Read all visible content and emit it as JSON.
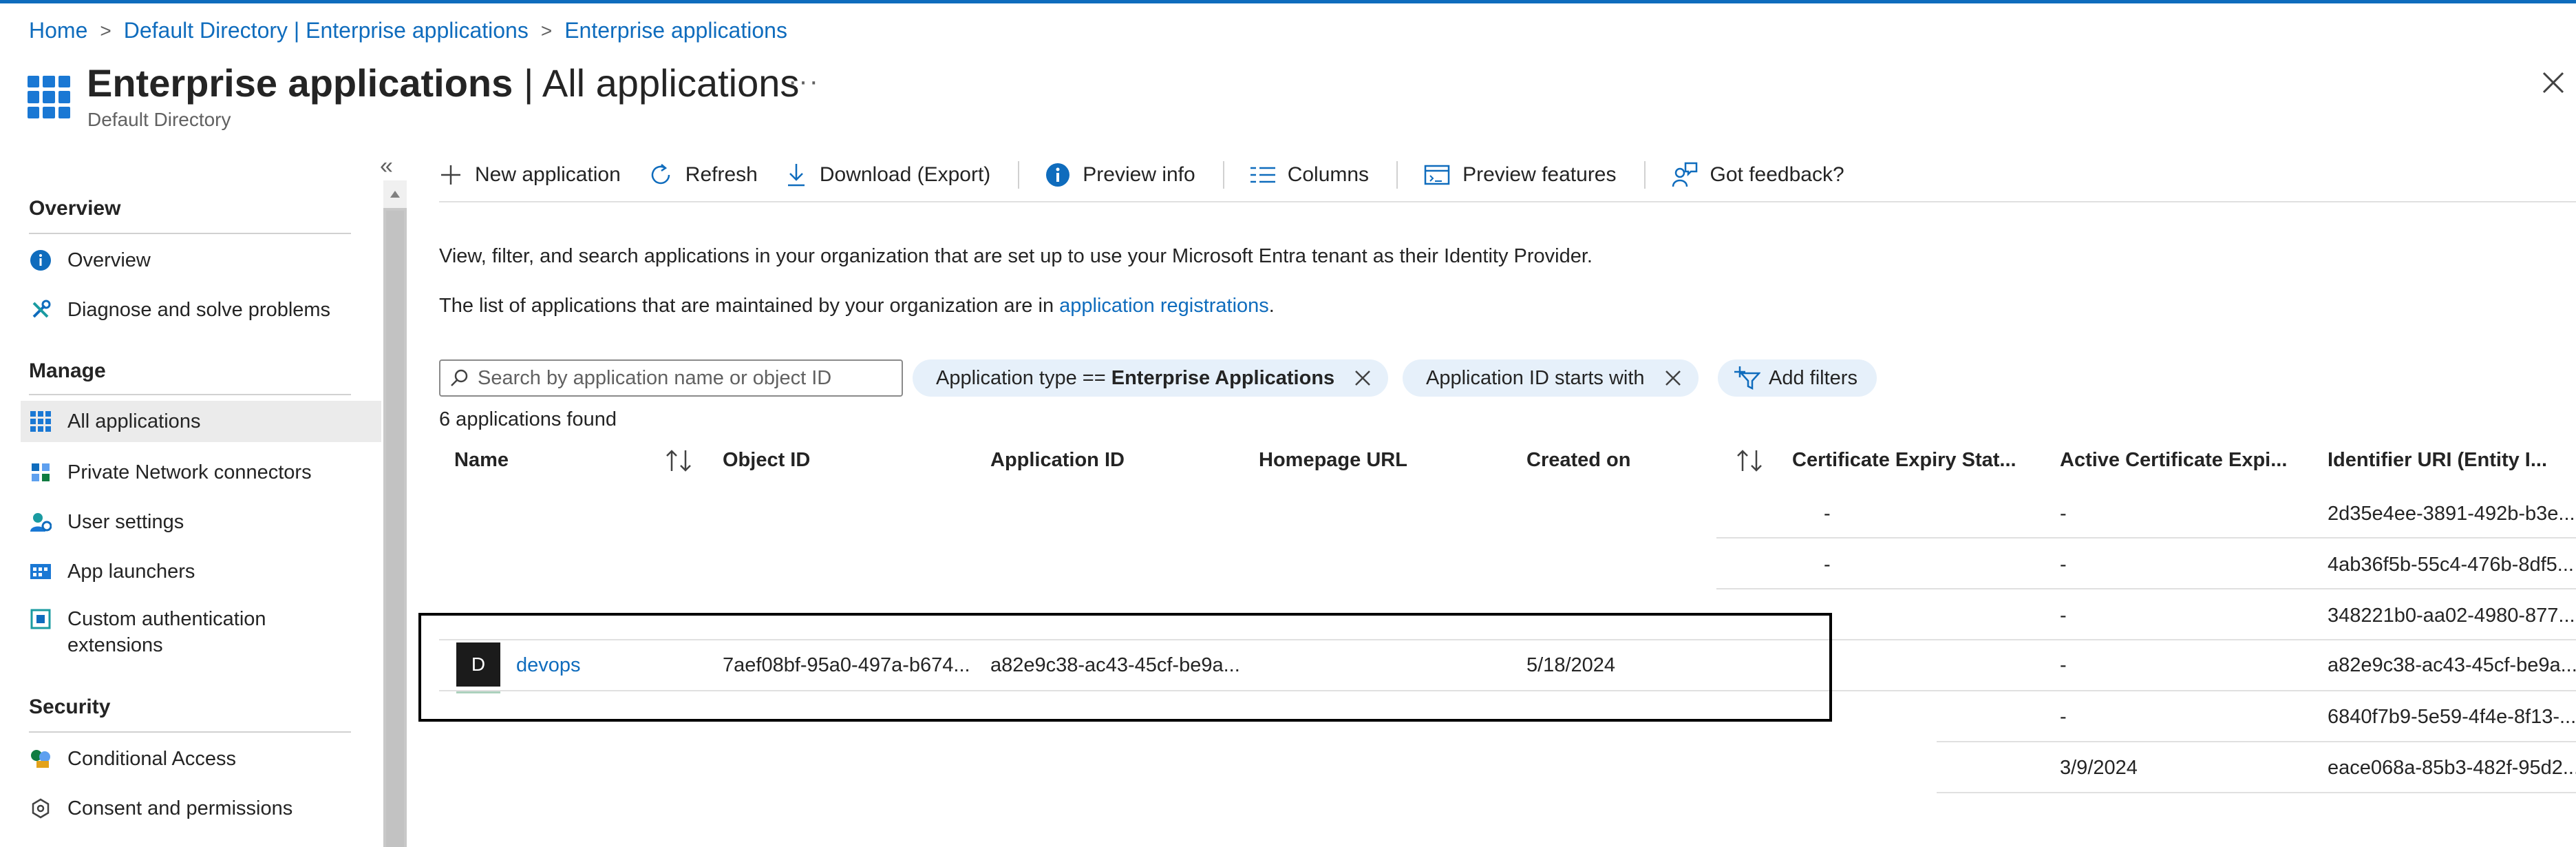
{
  "breadcrumb": [
    "Home",
    "Default Directory | Enterprise applications",
    "Enterprise applications"
  ],
  "header": {
    "title_main": "Enterprise applications",
    "title_sep": " | ",
    "title_sub": "All applications",
    "more": "···",
    "subtitle": "Default Directory"
  },
  "sidebar": {
    "collapse": "«",
    "sections": [
      {
        "heading": "Overview",
        "items": [
          {
            "label": "Overview",
            "icon": "info-icon"
          },
          {
            "label": "Diagnose and solve problems",
            "icon": "wrench-icon"
          }
        ]
      },
      {
        "heading": "Manage",
        "items": [
          {
            "label": "All applications",
            "icon": "grid-icon",
            "active": true
          },
          {
            "label": "Private Network connectors",
            "icon": "connector-icon"
          },
          {
            "label": "User settings",
            "icon": "user-settings-icon"
          },
          {
            "label": "App launchers",
            "icon": "app-launcher-icon"
          },
          {
            "label": "Custom authentication extensions",
            "icon": "extension-icon"
          }
        ]
      },
      {
        "heading": "Security",
        "items": [
          {
            "label": "Conditional Access",
            "icon": "conditional-access-icon"
          },
          {
            "label": "Consent and permissions",
            "icon": "gear-icon"
          }
        ]
      }
    ]
  },
  "toolbar": {
    "new_application": "New application",
    "refresh": "Refresh",
    "download": "Download (Export)",
    "preview_info": "Preview info",
    "columns": "Columns",
    "preview_features": "Preview features",
    "feedback": "Got feedback?"
  },
  "description": {
    "line1": "View, filter, and search applications in your organization that are set up to use your Microsoft Entra tenant as their Identity Provider.",
    "line2_prefix": "The list of applications that are maintained by your organization are in ",
    "line2_link": "application registrations",
    "line2_suffix": "."
  },
  "filters": {
    "search_placeholder": "Search by application name or object ID",
    "pill1_prefix": "Application type == ",
    "pill1_value": "Enterprise Applications",
    "pill2": "Application ID starts with",
    "add_filters": "Add filters"
  },
  "results_count": "6 applications found",
  "table": {
    "columns": [
      "Name",
      "Object ID",
      "Application ID",
      "Homepage URL",
      "Created on",
      "Certificate Expiry Stat...",
      "Active Certificate Expi...",
      "Identifier URI (Entity I..."
    ],
    "rows": [
      {
        "cert_status": "-",
        "active_cert": "-",
        "identifier": "2d35e4ee-3891-492b-b3e..."
      },
      {
        "cert_status": "-",
        "active_cert": "-",
        "identifier": "4ab36f5b-55c4-476b-8df5..."
      },
      {
        "cert_status": "",
        "active_cert": "-",
        "identifier": "348221b0-aa02-4980-877..."
      },
      {
        "avatar": "D",
        "name": "devops",
        "object_id": "7aef08bf-95a0-497a-b674...",
        "app_id": "a82e9c38-ac43-45cf-be9a...",
        "homepage": "",
        "created": "5/18/2024",
        "cert_status": "",
        "active_cert": "-",
        "identifier": "a82e9c38-ac43-45cf-be9a..."
      },
      {
        "cert_status": "",
        "active_cert": "-",
        "identifier": "6840f7b9-5e59-4f4e-8f13-..."
      },
      {
        "cert_status": "",
        "active_cert": "3/9/2024",
        "identifier": "eace068a-85b3-482f-95d2..."
      }
    ]
  },
  "colors": {
    "accent": "#0f6cbd",
    "pill_bg": "#e6f0fa",
    "grid_icon": "#1a78d4"
  }
}
